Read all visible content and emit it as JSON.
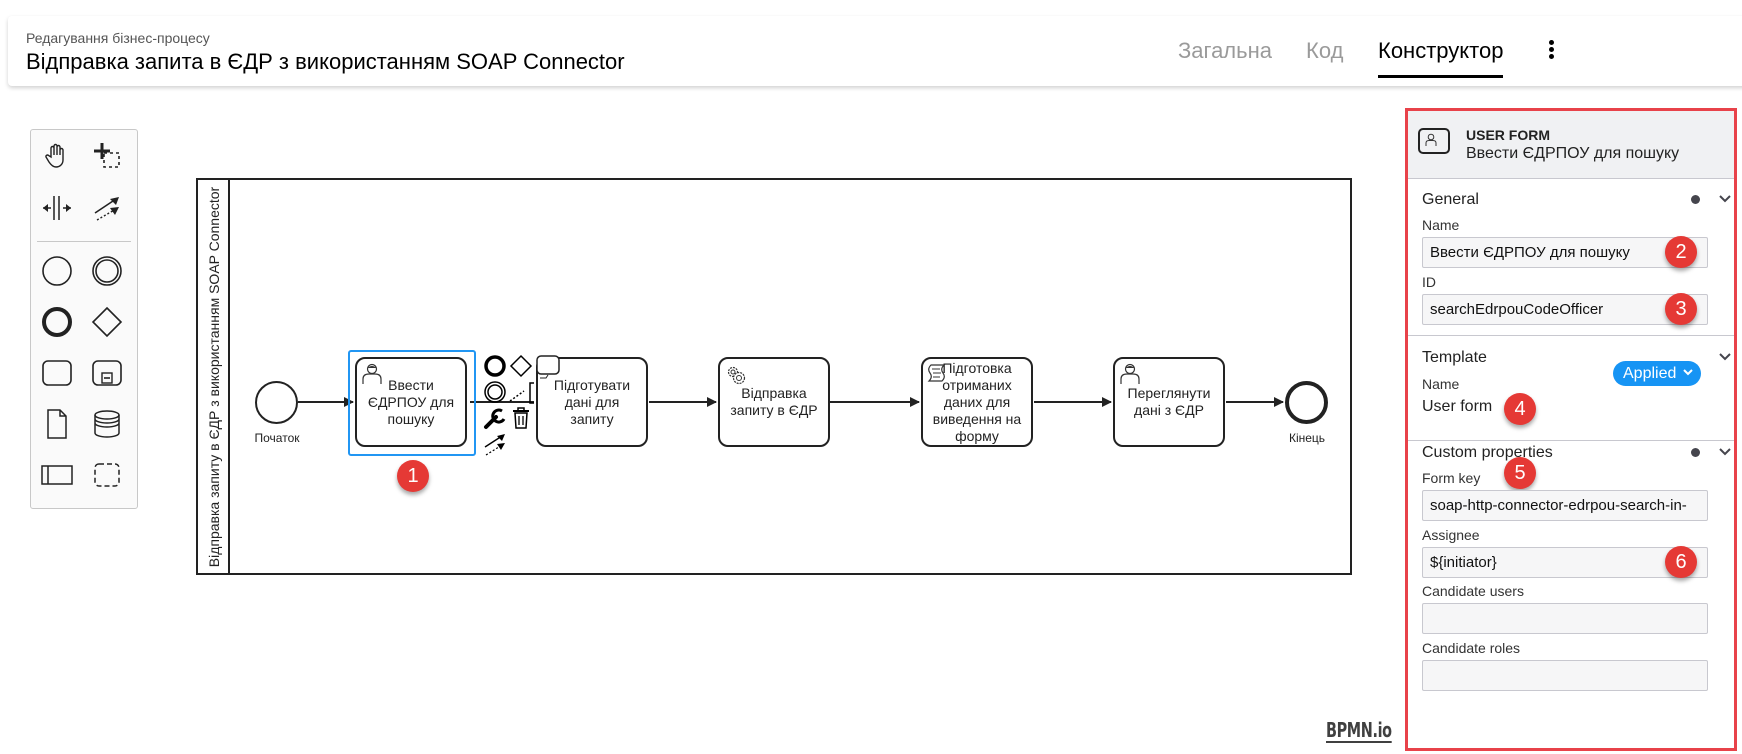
{
  "header": {
    "subtitle": "Редагування бізнес-процесу",
    "title": "Відправка запита в ЄДР з використанням SOAP Connector",
    "tabs": [
      {
        "label": "Загальна",
        "active": false
      },
      {
        "label": "Код",
        "active": false
      },
      {
        "label": "Конструктор",
        "active": true
      }
    ],
    "menu_icon": "more-vertical-icon"
  },
  "palette": {
    "tools": [
      {
        "name": "hand-tool",
        "icon": "hand-icon"
      },
      {
        "name": "lasso-tool",
        "icon": "lasso-icon"
      },
      {
        "name": "space-tool",
        "icon": "space-tool-icon"
      },
      {
        "name": "global-connect-tool",
        "icon": "connect-icon"
      },
      {
        "name": "create-start-event",
        "icon": "start-event-icon"
      },
      {
        "name": "create-intermediate-event",
        "icon": "intermediate-event-icon"
      },
      {
        "name": "create-end-event",
        "icon": "end-event-icon"
      },
      {
        "name": "create-gateway",
        "icon": "gateway-icon"
      },
      {
        "name": "create-task",
        "icon": "task-icon"
      },
      {
        "name": "create-subprocess",
        "icon": "subprocess-icon"
      },
      {
        "name": "create-data-object",
        "icon": "data-object-icon"
      },
      {
        "name": "create-data-store",
        "icon": "data-store-icon"
      },
      {
        "name": "create-pool",
        "icon": "pool-icon"
      },
      {
        "name": "create-group",
        "icon": "group-icon"
      }
    ]
  },
  "diagram": {
    "pool_label": "Відправка запиту в ЄДР з використанням SOAP Connector",
    "start_event": {
      "label": "Початок"
    },
    "end_event": {
      "label": "Кінець"
    },
    "tasks": [
      {
        "label": "Ввести ЄДРПОУ для пошуку",
        "type": "user-task",
        "selected": true
      },
      {
        "label": "Підготувати дані для запиту",
        "type": "task"
      },
      {
        "label": "Відправка запиту в ЄДР",
        "type": "service-task"
      },
      {
        "label": "Підготовка отриманих даних для виведення на форму",
        "type": "script-task"
      },
      {
        "label": "Переглянути дані з ЄДР",
        "type": "user-task"
      }
    ],
    "watermark": "BPMN.io"
  },
  "annotations": [
    "1",
    "2",
    "3",
    "4",
    "5",
    "6"
  ],
  "panel": {
    "element_type": "USER FORM",
    "element_name": "Ввести ЄДРПОУ для пошуку",
    "general": {
      "title": "General",
      "name_label": "Name",
      "name_value": "Ввести ЄДРПОУ для пошуку",
      "id_label": "ID",
      "id_value": "searchEdrpouCodeOfficer"
    },
    "template": {
      "title": "Template",
      "status": "Applied",
      "name_label": "Name",
      "name_value": "User form"
    },
    "custom": {
      "title": "Custom properties",
      "form_key_label": "Form key",
      "form_key_value": "soap-http-connector-edrpou-search-in-",
      "assignee_label": "Assignee",
      "assignee_value": "${initiator}",
      "candidate_users_label": "Candidate users",
      "candidate_users_value": "",
      "candidate_roles_label": "Candidate roles",
      "candidate_roles_value": ""
    },
    "colors": {
      "highlight_border": "#e8424a",
      "applied_badge": "#1694f4",
      "selection": "#2196f3"
    }
  }
}
